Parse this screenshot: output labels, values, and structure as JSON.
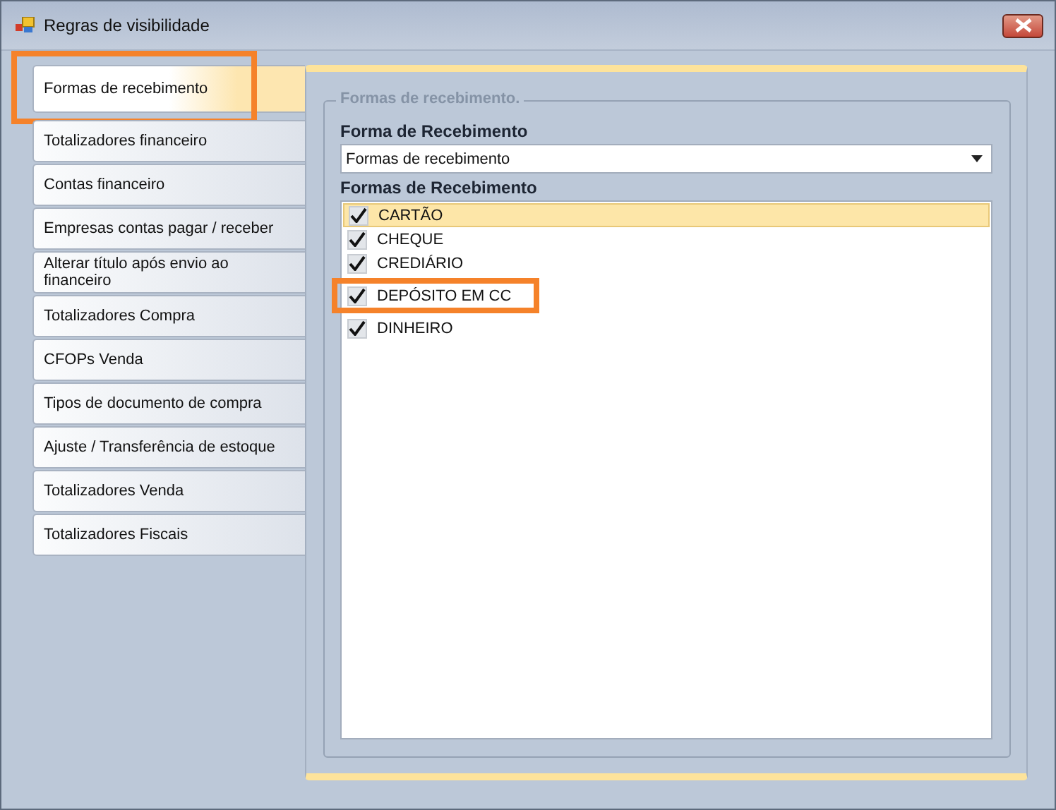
{
  "window": {
    "title": "Regras de visibilidade"
  },
  "tabs": [
    {
      "label": "Formas de recebimento",
      "selected": true,
      "highlighted": true
    },
    {
      "label": "Totalizadores financeiro",
      "selected": false,
      "highlighted": false
    },
    {
      "label": "Contas financeiro",
      "selected": false,
      "highlighted": false
    },
    {
      "label": "Empresas contas pagar / receber",
      "selected": false,
      "highlighted": false
    },
    {
      "label": "Alterar título após envio ao financeiro",
      "selected": false,
      "highlighted": false
    },
    {
      "label": "Totalizadores Compra",
      "selected": false,
      "highlighted": false
    },
    {
      "label": "CFOPs Venda",
      "selected": false,
      "highlighted": false
    },
    {
      "label": "Tipos de documento de compra",
      "selected": false,
      "highlighted": false
    },
    {
      "label": "Ajuste / Transferência de estoque",
      "selected": false,
      "highlighted": false
    },
    {
      "label": "Totalizadores Venda",
      "selected": false,
      "highlighted": false
    },
    {
      "label": "Totalizadores Fiscais",
      "selected": false,
      "highlighted": false
    }
  ],
  "group": {
    "title": "Formas de recebimento.",
    "combo_label": "Forma de Recebimento",
    "combo_value": "Formas de recebimento",
    "list_label": "Formas de Recebimento",
    "items": [
      {
        "label": "CARTÃO",
        "checked": true,
        "selected": true,
        "highlighted": false
      },
      {
        "label": "CHEQUE",
        "checked": true,
        "selected": false,
        "highlighted": false
      },
      {
        "label": "CREDIÁRIO",
        "checked": true,
        "selected": false,
        "highlighted": false
      },
      {
        "label": "DEPÓSITO EM CC",
        "checked": true,
        "selected": false,
        "highlighted": true
      },
      {
        "label": "DINHEIRO",
        "checked": true,
        "selected": false,
        "highlighted": false
      }
    ]
  }
}
